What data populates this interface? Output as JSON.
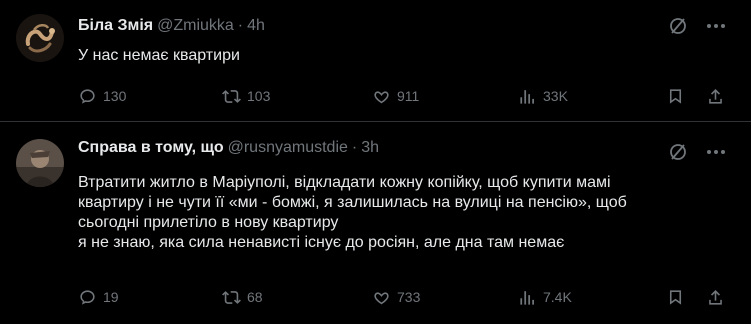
{
  "tweets": [
    {
      "display_name": "Біла Змія",
      "handle": "@Zmiukka",
      "dot": "·",
      "time": "4h",
      "text_lines": [
        "У нас немає квартири"
      ],
      "replies": "130",
      "retweets": "103",
      "likes": "911",
      "views": "33K",
      "icons": [
        "grok-icon",
        "more-icon",
        "reply-icon",
        "retweet-icon",
        "like-icon",
        "views-icon",
        "bookmark-icon",
        "share-icon"
      ]
    },
    {
      "display_name": "Справа в тому, що",
      "handle": "@rusnyamustdie",
      "dot": "·",
      "time": "3h",
      "text_lines": [
        "Втратити житло в Маріуполі, відкладати кожну копійку, щоб купити мамі",
        "квартиру і не чути її «ми - бомжі, я залишилась на вулиці на пенсію», щоб",
        "сьогодні прилетіло в нову квартиру",
        "я не знаю, яка сила ненависті існує до росіян, але дна там немає"
      ],
      "replies": "19",
      "retweets": "68",
      "likes": "733",
      "views": "7.4K",
      "icons": [
        "grok-icon",
        "more-icon",
        "reply-icon",
        "retweet-icon",
        "like-icon",
        "views-icon",
        "bookmark-icon",
        "share-icon"
      ]
    }
  ],
  "colors": {
    "background": "#000000",
    "primary_text": "#e7e9ea",
    "secondary_text": "#71767b",
    "divider": "#2f3336"
  }
}
